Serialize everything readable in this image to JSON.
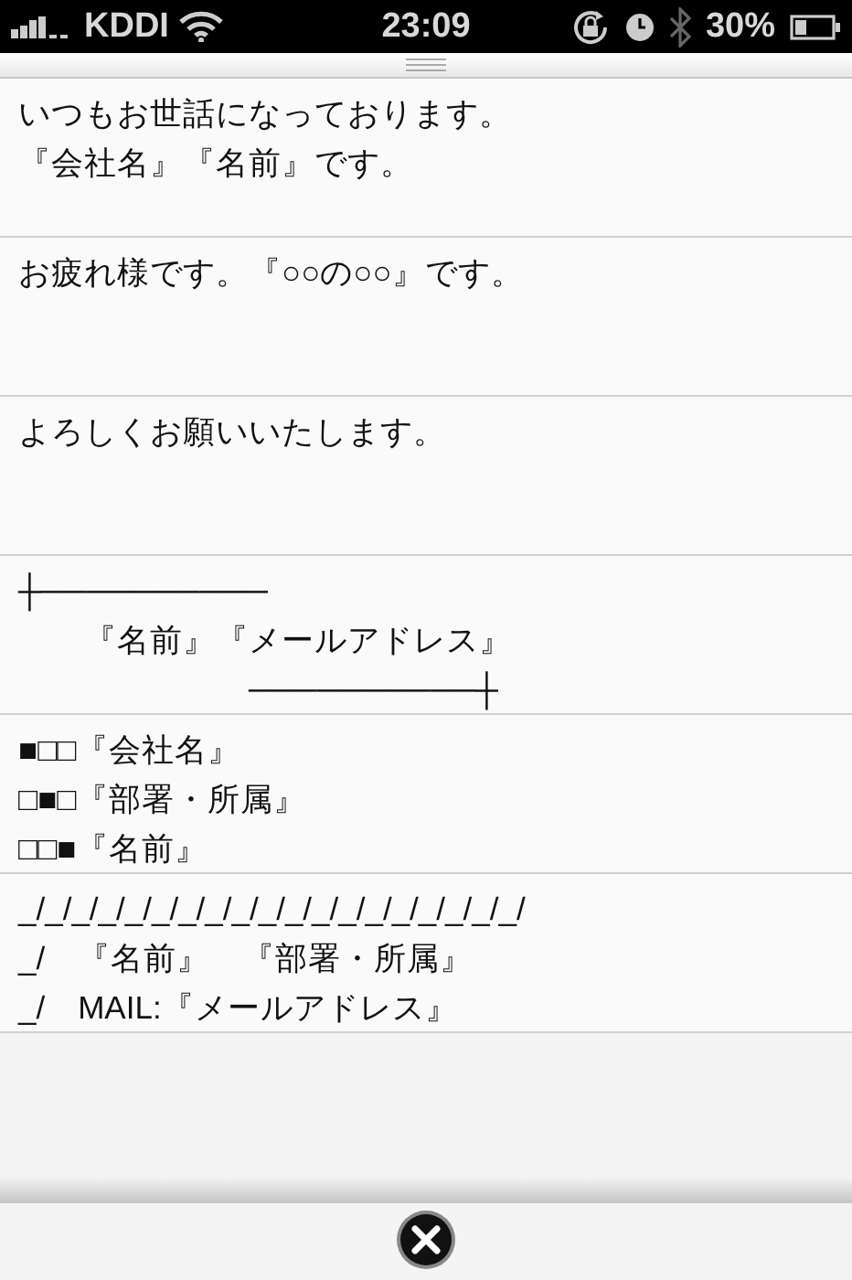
{
  "status_bar": {
    "carrier": "KDDI",
    "time": "23:09",
    "battery": "30%"
  },
  "templates": [
    {
      "lines": [
        "いつもお世話になっております。",
        "『会社名』『名前』です。"
      ]
    },
    {
      "lines": [
        "お疲れ様です。『○○の○○』です。"
      ]
    },
    {
      "lines": [
        "よろしくお願いいたします。"
      ]
    },
    {
      "lines": [
        "┼──────────",
        "　　『名前』『メールアドレス』",
        "　　　　　　　──────────┼"
      ]
    },
    {
      "lines": [
        "■□□『会社名』",
        "□■□『部署・所属』",
        "□□■『名前』"
      ]
    },
    {
      "lines": [
        "_/_/_/_/_/_/_/_/_/_/_/_/_/_/_/_/_/_/_/",
        "_/　『名前』　『部署・所属』",
        "_/　MAIL:『メールアドレス』"
      ]
    }
  ]
}
